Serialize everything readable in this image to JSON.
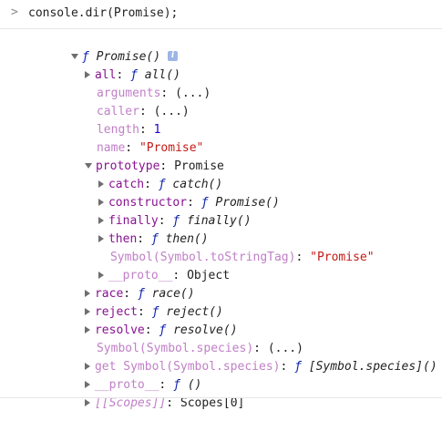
{
  "console": {
    "prompt_symbol": ">",
    "command": "console.dir(Promise);",
    "info_icon_letter": "i",
    "root": {
      "f": "ƒ",
      "name": "Promise()"
    },
    "rows": {
      "all": {
        "key": "all",
        "f": "ƒ",
        "value": "all()"
      },
      "arguments": {
        "key": "arguments",
        "value": "(...)"
      },
      "caller": {
        "key": "caller",
        "value": "(...)"
      },
      "length": {
        "key": "length",
        "value": "1"
      },
      "name": {
        "key": "name",
        "value": "\"Promise\""
      },
      "prototype": {
        "key": "prototype",
        "value": "Promise"
      },
      "catch": {
        "key": "catch",
        "f": "ƒ",
        "value": "catch()"
      },
      "constructor": {
        "key": "constructor",
        "f": "ƒ",
        "value": "Promise()"
      },
      "finally": {
        "key": "finally",
        "f": "ƒ",
        "value": "finally()"
      },
      "then": {
        "key": "then",
        "f": "ƒ",
        "value": "then()"
      },
      "tostringtag": {
        "key": "Symbol(Symbol.toStringTag)",
        "value": "\"Promise\""
      },
      "proto_inner": {
        "key": "__proto__",
        "value": "Object"
      },
      "race": {
        "key": "race",
        "f": "ƒ",
        "value": "race()"
      },
      "reject": {
        "key": "reject",
        "f": "ƒ",
        "value": "reject()"
      },
      "resolve": {
        "key": "resolve",
        "f": "ƒ",
        "value": "resolve()"
      },
      "species": {
        "key": "Symbol(Symbol.species)",
        "value": "(...)"
      },
      "get_species": {
        "prefix": "get",
        "key": "Symbol(Symbol.species)",
        "f": "ƒ",
        "value": "[Symbol.species]()"
      },
      "proto_outer": {
        "key": "__proto__",
        "f": "ƒ",
        "value": "()"
      },
      "scopes": {
        "key": "[[Scopes]]",
        "value": "Scopes[0]"
      }
    },
    "colors": {
      "key": "#881391",
      "dim_key": "#c080c7",
      "function_name": "#0d22aa",
      "string": "#c41a16",
      "number": "#1c00cf",
      "arrow": "#6e6e6e"
    }
  }
}
